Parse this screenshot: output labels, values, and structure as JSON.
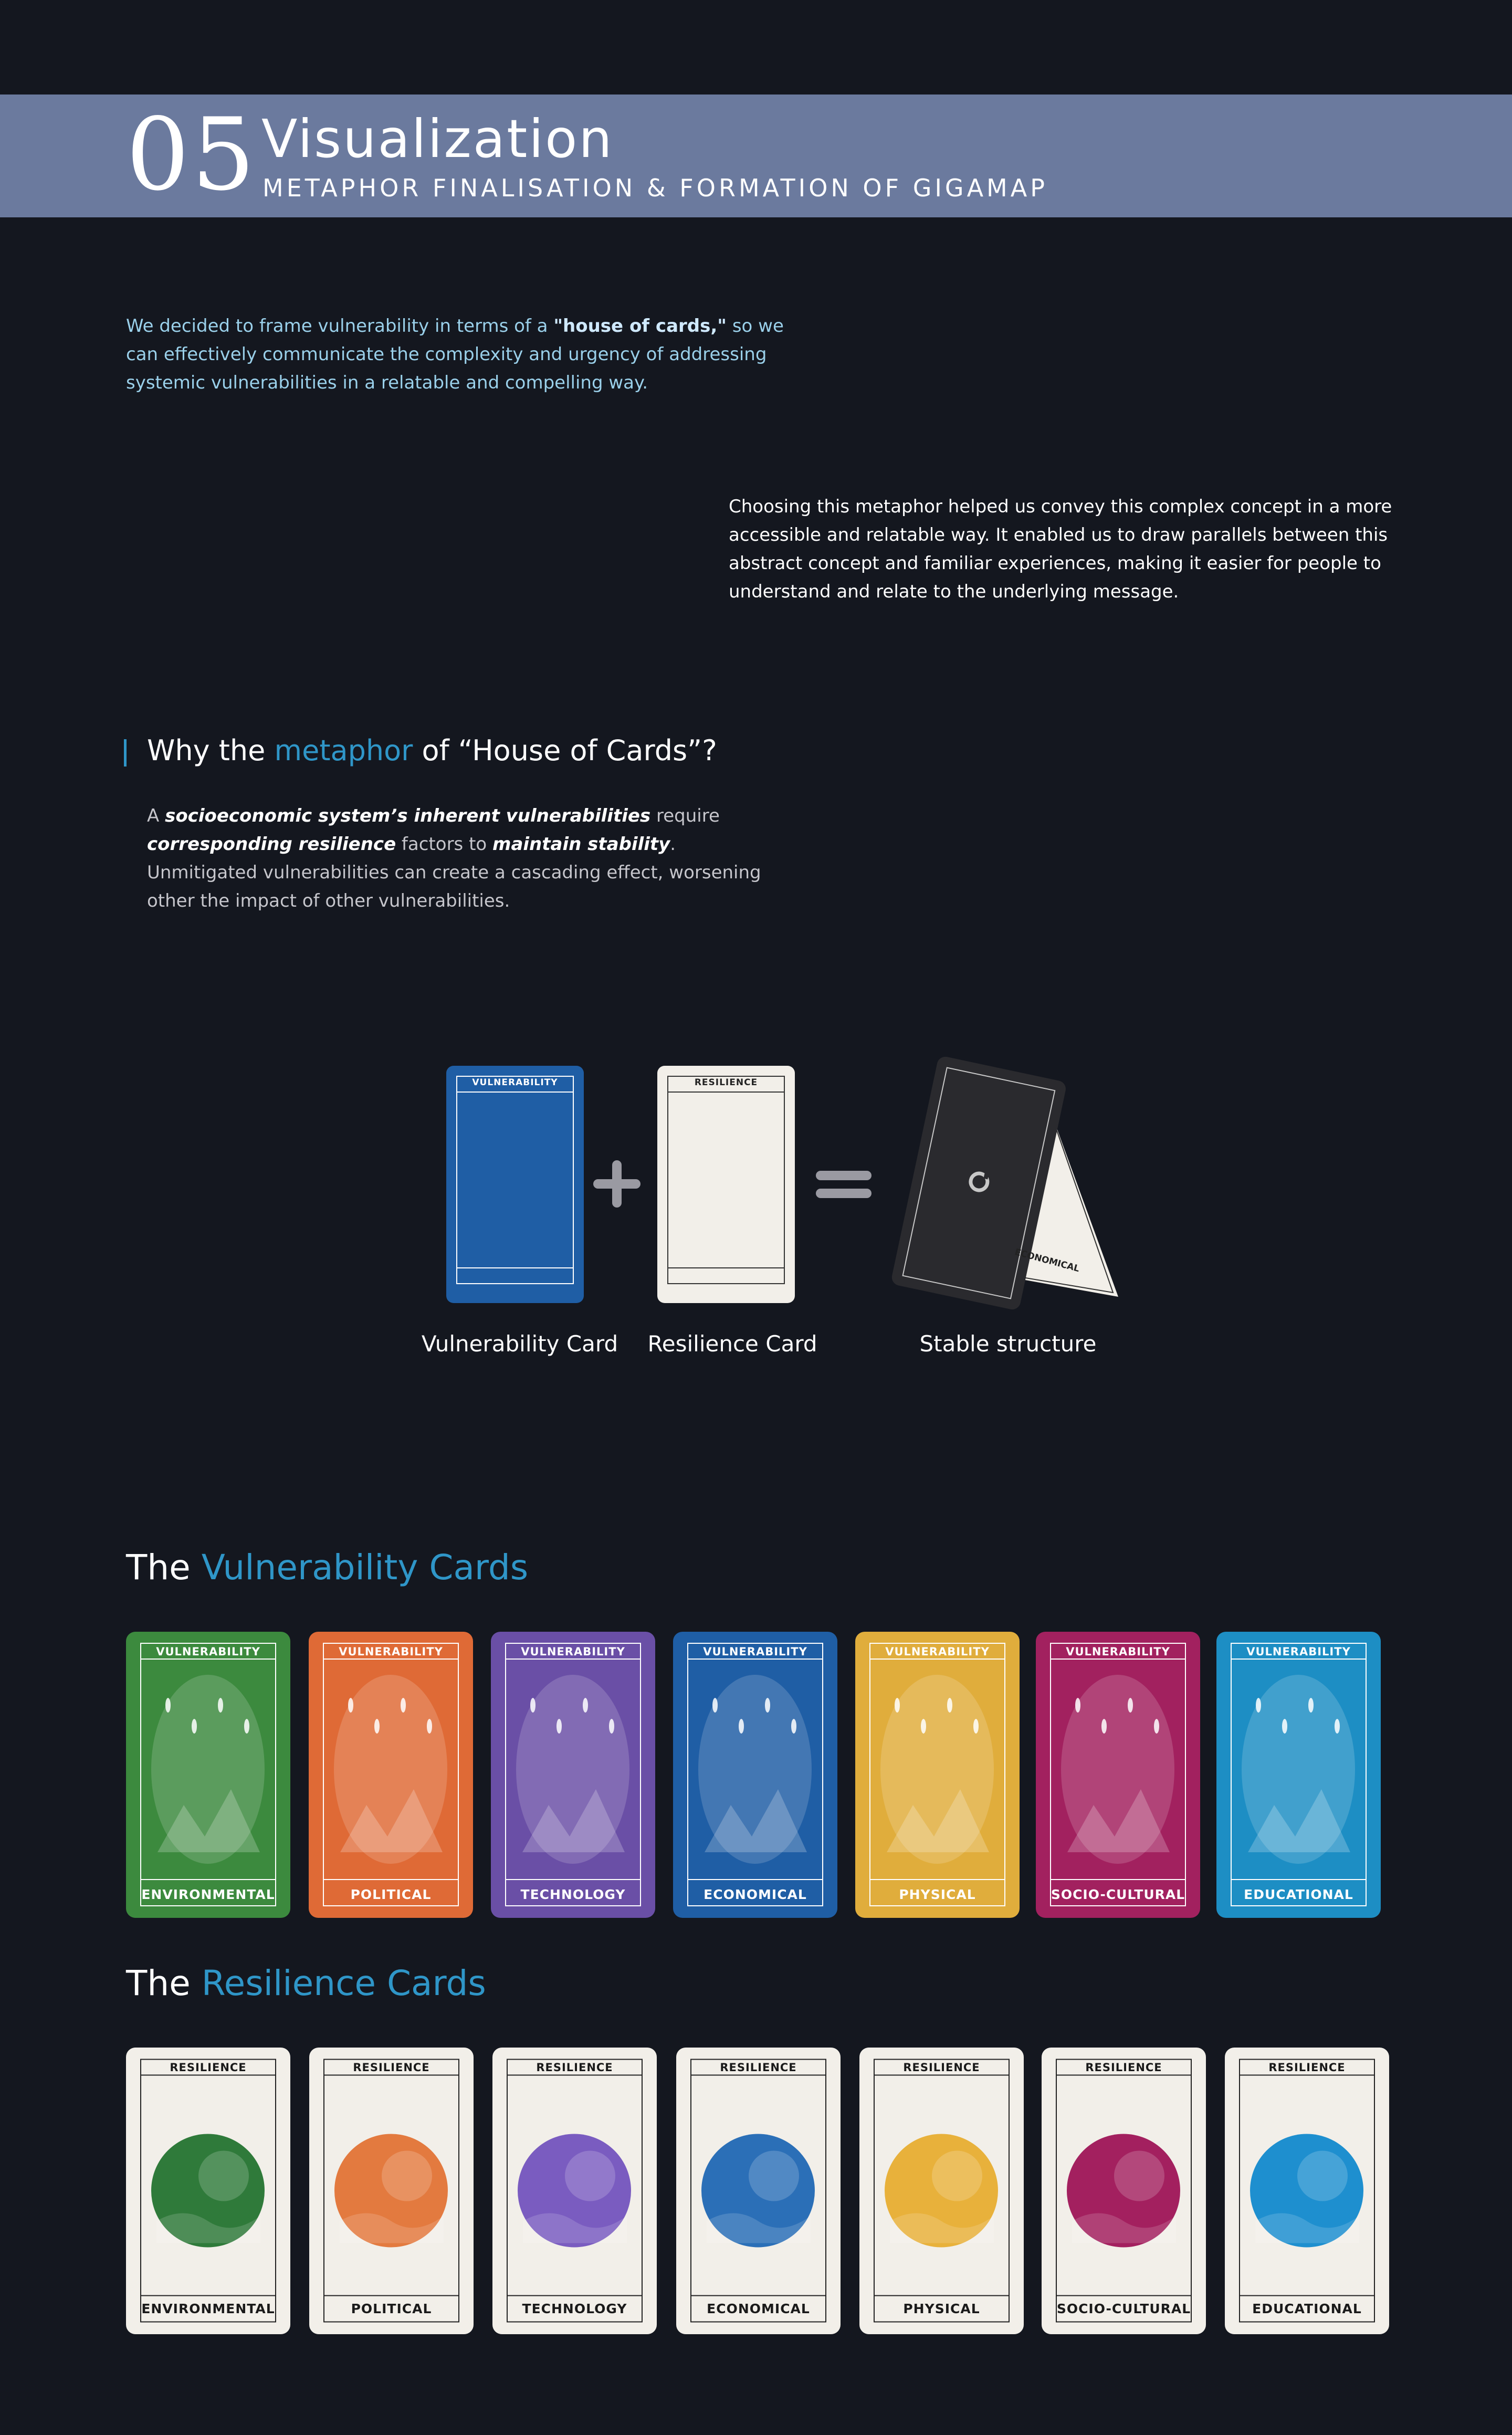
{
  "header": {
    "number": "05",
    "title": "Visualization",
    "subtitle": "METAPHOR FINALISATION & FORMATION OF GIGAMAP"
  },
  "intro": {
    "part1": "We decided to frame vulnerability in terms of a ",
    "highlight": "\"house of cards,\"",
    "part2": " so we can effectively communicate the complexity and urgency of addressing systemic vulnerabilities in a relatable and compelling way."
  },
  "choosing": "Choosing this metaphor helped us convey this complex concept in a more accessible and relatable way. It enabled us to draw parallels between this abstract concept and familiar experiences, making it easier for people to understand and relate to the underlying message.",
  "why": {
    "heading_prefix": "Why the ",
    "heading_accent": "metaphor",
    "heading_suffix": "  of “House of Cards”?",
    "p1": "A ",
    "b1": "socioeconomic system’s inherent vulnerabilities",
    "p2": " require ",
    "b2": "corresponding resilience",
    "p3": " factors to ",
    "b3": "maintain stability",
    "p4": ". Unmitigated vulnerabilities can create a cascading effect, worsening other the impact of other vulnerabilities."
  },
  "equation": {
    "vuln_card_top": "VULNERABILITY",
    "res_card_top": "RESILIENCE",
    "tent_label": "ECONOMICAL",
    "vuln_label": "Vulnerability Card",
    "res_label": "Resilience Card",
    "stable_label": "Stable structure"
  },
  "vulnerability_cards": {
    "heading_prefix": "The ",
    "heading_accent": "Vulnerability Cards",
    "cards": [
      {
        "top": "VULNERABILITY",
        "label": "ENVIRONMENTAL",
        "color": "#3c8a3e"
      },
      {
        "top": "VULNERABILITY",
        "label": "POLITICAL",
        "color": "#df6a36"
      },
      {
        "top": "VULNERABILITY",
        "label": "TECHNOLOGY",
        "color": "#6a4fa6"
      },
      {
        "top": "VULNERABILITY",
        "label": "ECONOMICAL",
        "color": "#1f5ea5"
      },
      {
        "top": "VULNERABILITY",
        "label": "PHYSICAL",
        "color": "#e0ad3c"
      },
      {
        "top": "VULNERABILITY",
        "label": "SOCIO-CULTURAL",
        "color": "#a2215f"
      },
      {
        "top": "VULNERABILITY",
        "label": "EDUCATIONAL",
        "color": "#1d8ec4"
      }
    ]
  },
  "resilience_cards": {
    "heading_prefix": "The ",
    "heading_accent": "Resilience Cards",
    "cards": [
      {
        "top": "RESILIENCE",
        "label": "ENVIRONMENTAL",
        "color": "#2f7a3a"
      },
      {
        "top": "RESILIENCE",
        "label": "POLITICAL",
        "color": "#e37a3f"
      },
      {
        "top": "RESILIENCE",
        "label": "TECHNOLOGY",
        "color": "#7a5cc0"
      },
      {
        "top": "RESILIENCE",
        "label": "ECONOMICAL",
        "color": "#2b6fb7"
      },
      {
        "top": "RESILIENCE",
        "label": "PHYSICAL",
        "color": "#e8b13b"
      },
      {
        "top": "RESILIENCE",
        "label": "SOCIO-CULTURAL",
        "color": "#a3205f"
      },
      {
        "top": "RESILIENCE",
        "label": "EDUCATIONAL",
        "color": "#1e8fcf"
      }
    ]
  }
}
